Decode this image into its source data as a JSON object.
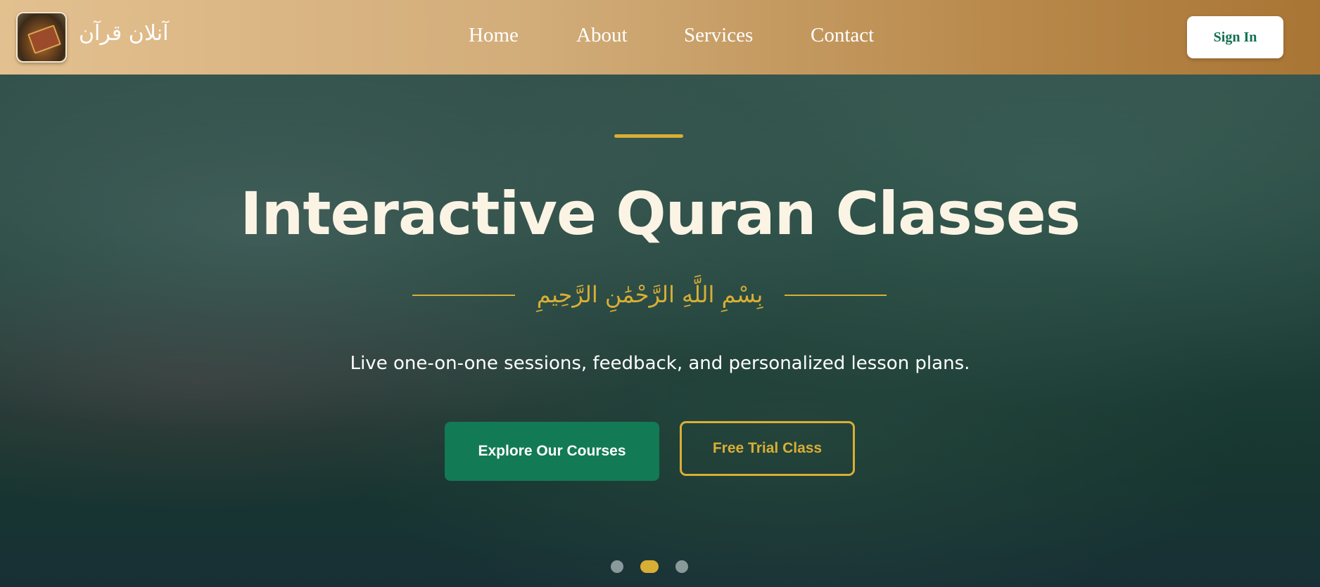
{
  "header": {
    "logo_text": "آنلان قرآن",
    "nav": [
      "Home",
      "About",
      "Services",
      "Contact"
    ],
    "sign_in": "Sign In"
  },
  "hero": {
    "title": "Interactive Quran Classes",
    "bismillah": "بِسْمِ اللَّهِ الرَّحْمَٰنِ الرَّحِيمِ",
    "subtitle": "Live one-on-one sessions, feedback, and personalized lesson plans.",
    "primary_button": "Explore Our Courses",
    "secondary_button": "Free Trial Class",
    "slides": 3,
    "active_slide": 2
  },
  "colors": {
    "accent_gold": "#d9ae35",
    "primary_green": "#127a55"
  }
}
